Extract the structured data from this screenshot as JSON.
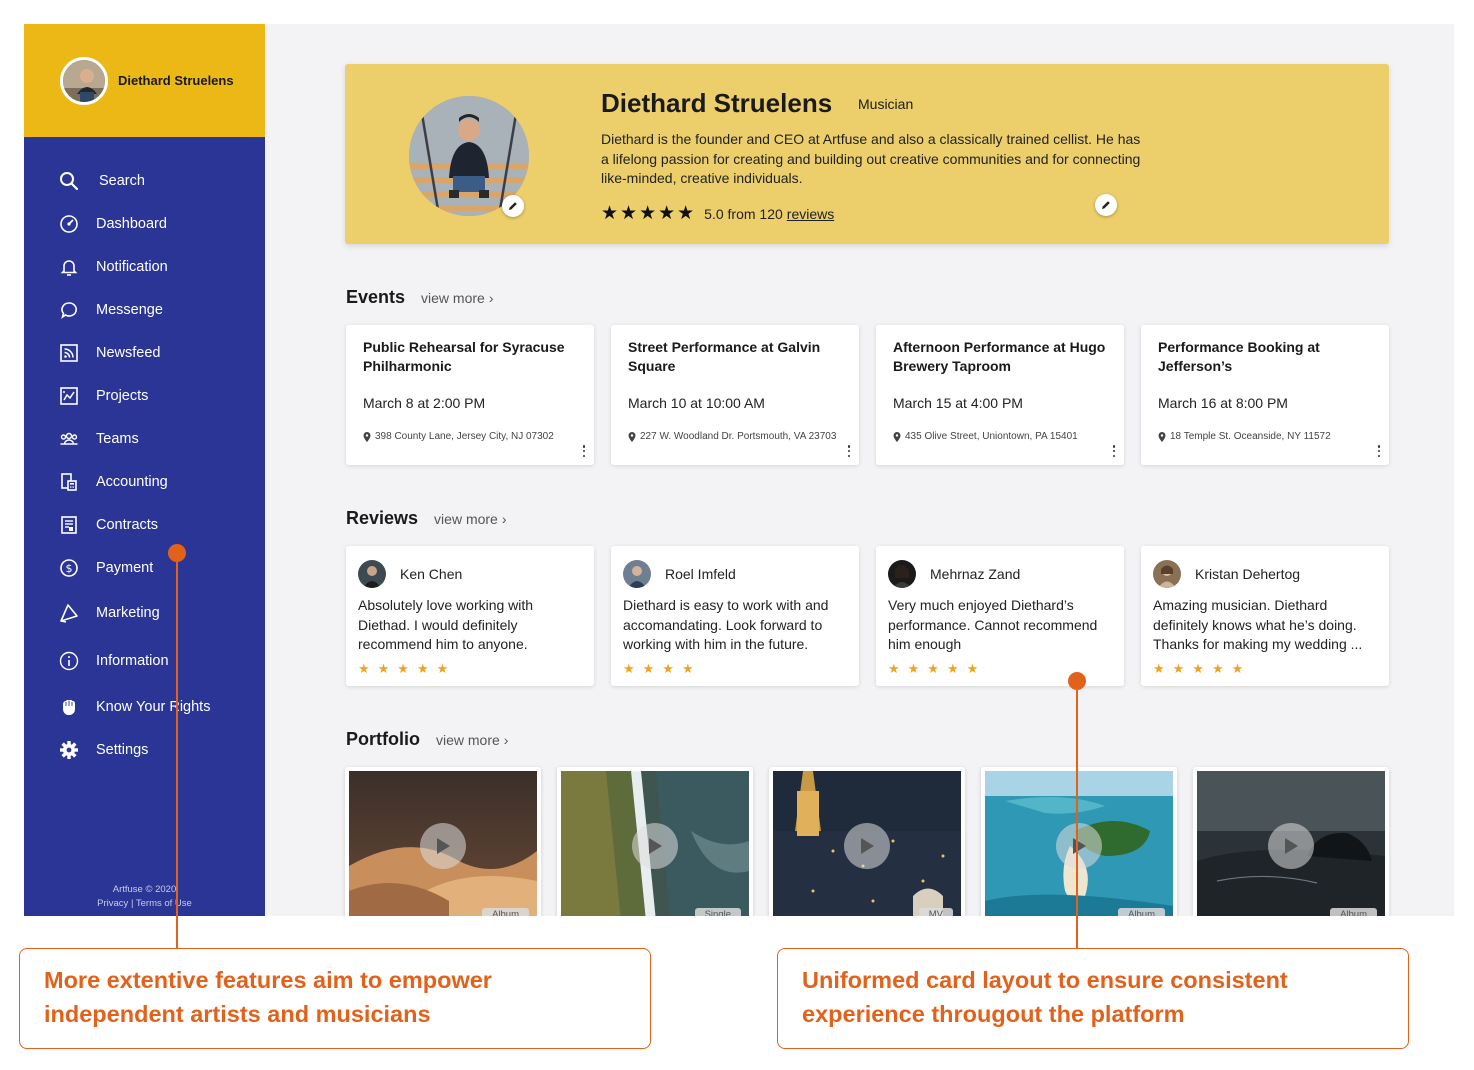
{
  "user": {
    "name": "Diethard Struelens"
  },
  "nav": [
    {
      "label": "Search",
      "icon": "search-icon"
    },
    {
      "label": "Dashboard",
      "icon": "dashboard-icon"
    },
    {
      "label": "Notification",
      "icon": "bell-icon"
    },
    {
      "label": "Messenge",
      "icon": "chat-icon"
    },
    {
      "label": "Newsfeed",
      "icon": "rss-icon"
    },
    {
      "label": "Projects",
      "icon": "chart-board-icon"
    },
    {
      "label": "Teams",
      "icon": "team-icon"
    },
    {
      "label": "Accounting",
      "icon": "calculator-icon"
    },
    {
      "label": "Contracts",
      "icon": "contract-icon"
    },
    {
      "label": "Payment",
      "icon": "dollar-icon"
    },
    {
      "label": "Marketing",
      "icon": "megaphone-icon"
    },
    {
      "label": "Information",
      "icon": "info-icon"
    },
    {
      "label": "Know Your Rights",
      "icon": "fist-icon"
    },
    {
      "label": "Settings",
      "icon": "gear-icon"
    }
  ],
  "footer": {
    "copyright": "Artfuse © 2020",
    "privacy": "Privacy",
    "separator": "|",
    "terms": "Terms of Use"
  },
  "profile": {
    "name": "Diethard Struelens",
    "role": "Musician",
    "bio": "Diethard is the founder and CEO at Artfuse and also a classically trained cellist. He has a lifelong passion for creating and building out creative communities and for connecting like-minded, creative individuals.",
    "rating_text": "5.0 from 120",
    "reviews_link": "reviews"
  },
  "events": {
    "title": "Events",
    "view_more": "view more",
    "items": [
      {
        "title": "Public Rehearsal for Syracuse Philharmonic",
        "date": "March 8 at 2:00 PM",
        "address": "398 County Lane, Jersey City, NJ 07302"
      },
      {
        "title": "Street Performance at Galvin Square",
        "date": "March 10 at 10:00 AM",
        "address": "227 W. Woodland Dr. Portsmouth, VA 23703"
      },
      {
        "title": "Afternoon Performance at Hugo Brewery Taproom",
        "date": "March 15 at 4:00 PM",
        "address": "435 Olive Street, Uniontown, PA 15401"
      },
      {
        "title": "Performance Booking at Jefferson’s",
        "date": "March 16 at 8:00 PM",
        "address": "18 Temple St. Oceanside, NY 11572"
      }
    ]
  },
  "reviews": {
    "title": "Reviews",
    "view_more": "view more",
    "items": [
      {
        "name": "Ken Chen",
        "text": "Absolutely love working with Diethad. I would definitely recommend him to anyone.",
        "stars": 5
      },
      {
        "name": "Roel Imfeld",
        "text": "Diethard is easy to work with and accomandating. Look forward to working with him in the future.",
        "stars": 4
      },
      {
        "name": "Mehrnaz Zand",
        "text": "Very much enjoyed Diethard’s performance. Cannot recommend him enough",
        "stars": 5
      },
      {
        "name": "Kristan Dehertog",
        "text": "Amazing musician. Diethard definitely knows what he’s doing. Thanks for making my wedding ...",
        "stars": 5
      }
    ]
  },
  "portfolio": {
    "title": "Portfolio",
    "view_more": "view more",
    "items": [
      {
        "tag": "Album"
      },
      {
        "tag": "Single"
      },
      {
        "tag": "MV"
      },
      {
        "tag": "Album"
      },
      {
        "tag": "Album"
      }
    ]
  },
  "annotations": {
    "left": "More extentive features aim to empower independent artists and musicians",
    "right": "Uniformed card layout to ensure consistent experience througout the platform"
  },
  "colors": {
    "sidebar": "#2b3595",
    "brand_yellow": "#ecb816",
    "hero": "#eccf6a",
    "star": "#f0a323",
    "annotation": "#e2621b"
  }
}
